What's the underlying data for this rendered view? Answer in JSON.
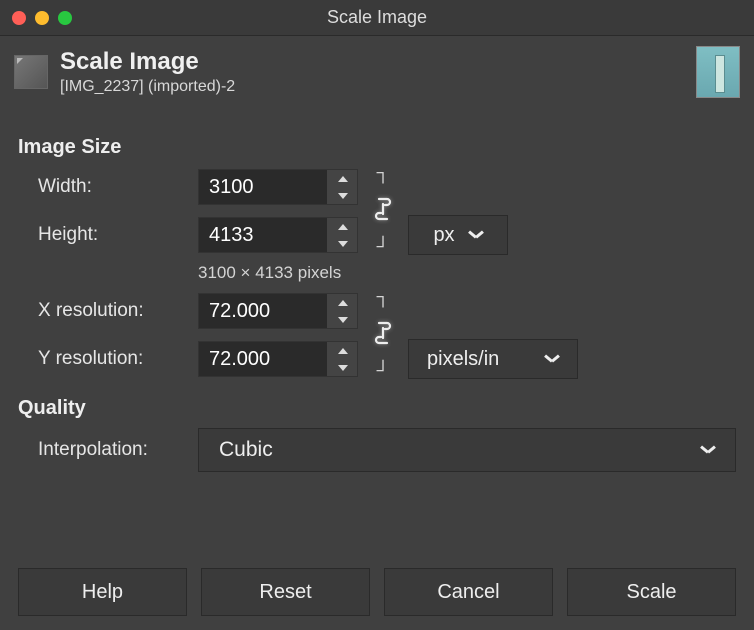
{
  "window": {
    "title": "Scale Image"
  },
  "header": {
    "title": "Scale Image",
    "subtitle": "[IMG_2237] (imported)-2"
  },
  "sections": {
    "image_size": {
      "heading": "Image Size",
      "width_label": "Width:",
      "height_label": "Height:",
      "width": "3100",
      "height": "4133",
      "readout": "3100 × 4133 pixels",
      "unit": "px",
      "xres_label": "X resolution:",
      "yres_label": "Y resolution:",
      "xres": "72.000",
      "yres": "72.000",
      "res_unit": "pixels/in"
    },
    "quality": {
      "heading": "Quality",
      "interp_label": "Interpolation:",
      "interp_value": "Cubic"
    }
  },
  "buttons": {
    "help": "Help",
    "reset": "Reset",
    "cancel": "Cancel",
    "scale": "Scale"
  },
  "icons": {
    "chain_linked": "linked"
  }
}
